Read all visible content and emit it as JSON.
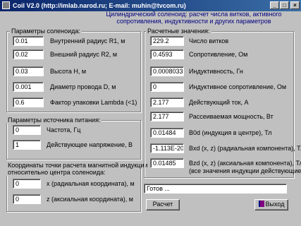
{
  "window": {
    "title": "Coil V2.0 (http://imlab.narod.ru; E-mail: muhin@tvcom.ru)",
    "minimize": "_",
    "maximize": "□",
    "close": "×"
  },
  "subtitle": "Цилиндрический соленоид: расчет числа витков, активного сопротивления, индуктивности и других параметров",
  "solenoid": {
    "title": "Параметры соленоида:",
    "params": [
      {
        "value": "0.01",
        "label": "Внутренний радиус R1, м"
      },
      {
        "value": "0.02",
        "label": "Внешний радиус R2, м"
      },
      {
        "value": "0.03",
        "label": "Высота H, м"
      },
      {
        "value": "0.001",
        "label": "Диаметр провода D, м"
      },
      {
        "value": "0.6",
        "label": "Фактор упаковки Lambda (<1)"
      }
    ]
  },
  "source": {
    "title": "Параметры источника питания:",
    "params": [
      {
        "value": "0",
        "label": "Частота, Гц"
      },
      {
        "value": "1",
        "label": "Действующее напряжение, В"
      }
    ]
  },
  "coords": {
    "title_line1": "Координаты точки расчета магнитной индукции",
    "title_line2": "относительно центра соленоида:",
    "params": [
      {
        "value": "0",
        "label": "x (радиальная координата), м"
      },
      {
        "value": "0",
        "label": "z (аксиальная координата), м"
      }
    ]
  },
  "results": {
    "title": "Расчетные значения:",
    "items": [
      {
        "value": "229.2",
        "label": "Число витков"
      },
      {
        "value": "0.4593",
        "label": "Сопротивление, Ом"
      },
      {
        "value": "0.0008033",
        "label": "Индуктивность, Гн"
      },
      {
        "value": "0",
        "label": "Индуктивное сопротивление, Ом"
      },
      {
        "value": "2.177",
        "label": "Действующий ток, А"
      },
      {
        "value": "2.177",
        "label": "Рассеиваемая мощность, Вт"
      },
      {
        "value": "0.01484",
        "label": "B0d (индукция в центре), Тл"
      },
      {
        "value": "-1.113E-20",
        "label": "Bxd (x, z) (радиальная компонента), Тл"
      },
      {
        "value": "0.01485",
        "label": "Bzd (x, z) (аксиальная компонента), Тл"
      }
    ],
    "note": "(все значения индукции действующие)"
  },
  "status": "Готов ...",
  "buttons": {
    "calc": "Расчет",
    "exit": "Выход"
  }
}
